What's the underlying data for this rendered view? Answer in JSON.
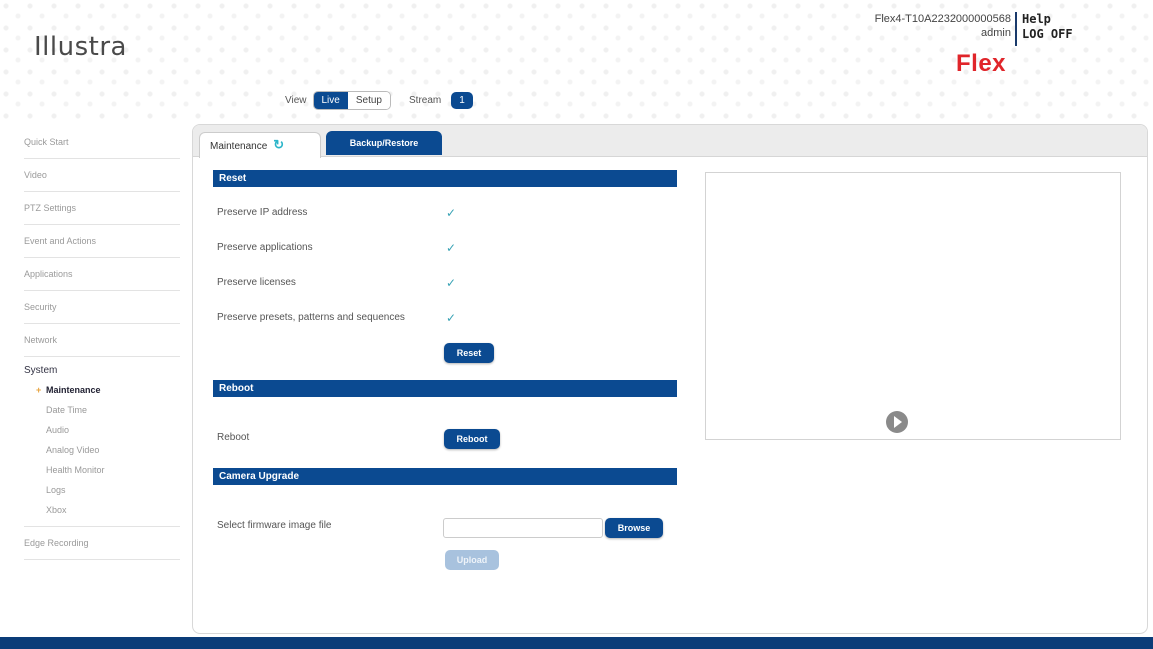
{
  "header": {
    "logo": "Illustra",
    "device_name": "Flex4-T10A2232000000568",
    "user": "admin",
    "help": "Help",
    "logoff": "LOG OFF",
    "brand": "Flex"
  },
  "view_bar": {
    "view_label": "View",
    "live_label": "Live",
    "setup_label": "Setup",
    "stream_label": "Stream",
    "stream_value": "1"
  },
  "sidebar": {
    "items": [
      "Quick Start",
      "Video",
      "PTZ Settings",
      "Event and Actions",
      "Applications",
      "Security",
      "Network"
    ],
    "system_title": "System",
    "system_items": [
      "Maintenance",
      "Date Time",
      "Audio",
      "Analog Video",
      "Health Monitor",
      "Logs",
      "Xbox"
    ],
    "edge_recording": "Edge Recording"
  },
  "tabs": {
    "maintenance": "Maintenance",
    "backup_restore": "Backup/Restore"
  },
  "reset": {
    "header": "Reset",
    "preserve_ip": "Preserve IP address",
    "preserve_apps": "Preserve applications",
    "preserve_licenses": "Preserve licenses",
    "preserve_presets": "Preserve presets, patterns and sequences",
    "button": "Reset"
  },
  "reboot": {
    "header": "Reboot",
    "label": "Reboot",
    "button": "Reboot"
  },
  "upgrade": {
    "header": "Camera Upgrade",
    "label": "Select firmware image file",
    "file_value": "",
    "browse_button": "Browse",
    "upload_button": "Upload"
  },
  "colors": {
    "primary": "#0b4a91",
    "brand_red": "#e0252a",
    "footer": "#0b3c78"
  }
}
